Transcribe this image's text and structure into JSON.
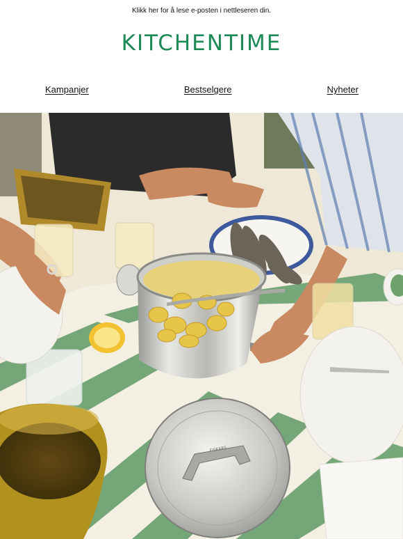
{
  "header": {
    "preheader_link": "Klikk her for å lese e-posten i nettleseren din.",
    "logo_text": "KITCHENTIME",
    "brand_color": "#1c8a55"
  },
  "nav": {
    "items": [
      {
        "label": "Kampanjer"
      },
      {
        "label": "Bestselgere"
      },
      {
        "label": "Nyheter"
      }
    ]
  },
  "hero": {
    "lid_brand": "FISKARS"
  }
}
